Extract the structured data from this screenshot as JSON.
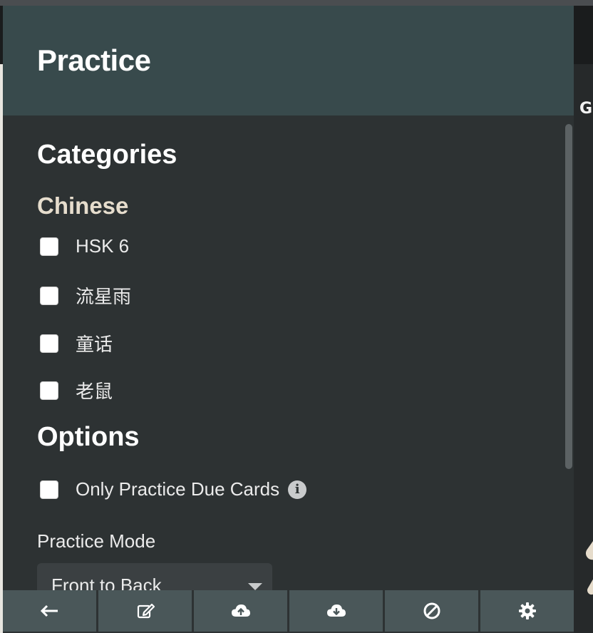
{
  "window": {
    "title": "Practice"
  },
  "categories": {
    "heading": "Categories",
    "groups": [
      {
        "name": "Chinese",
        "items": [
          {
            "label": "HSK 6",
            "checked": false
          },
          {
            "label": "流星雨",
            "checked": false
          },
          {
            "label": "童话",
            "checked": false
          },
          {
            "label": "老鼠",
            "checked": false
          }
        ]
      }
    ]
  },
  "options": {
    "heading": "Options",
    "only_due": {
      "label": "Only Practice Due Cards",
      "checked": false,
      "info_icon": "info-icon"
    },
    "practice_mode": {
      "label": "Practice Mode",
      "selected": "Front to Back"
    }
  },
  "backdrop": {
    "right_letter": "G"
  },
  "toolbar": {
    "buttons": [
      {
        "icon": "back-arrow-icon"
      },
      {
        "icon": "edit-icon"
      },
      {
        "icon": "cloud-upload-icon"
      },
      {
        "icon": "cloud-download-icon"
      },
      {
        "icon": "ban-icon"
      },
      {
        "icon": "gear-icon"
      }
    ]
  },
  "colors": {
    "header_bg": "#384a4c",
    "panel_bg": "#2d3233",
    "subheading": "#e6ddcd",
    "toolbar_bg": "#4a5759"
  }
}
